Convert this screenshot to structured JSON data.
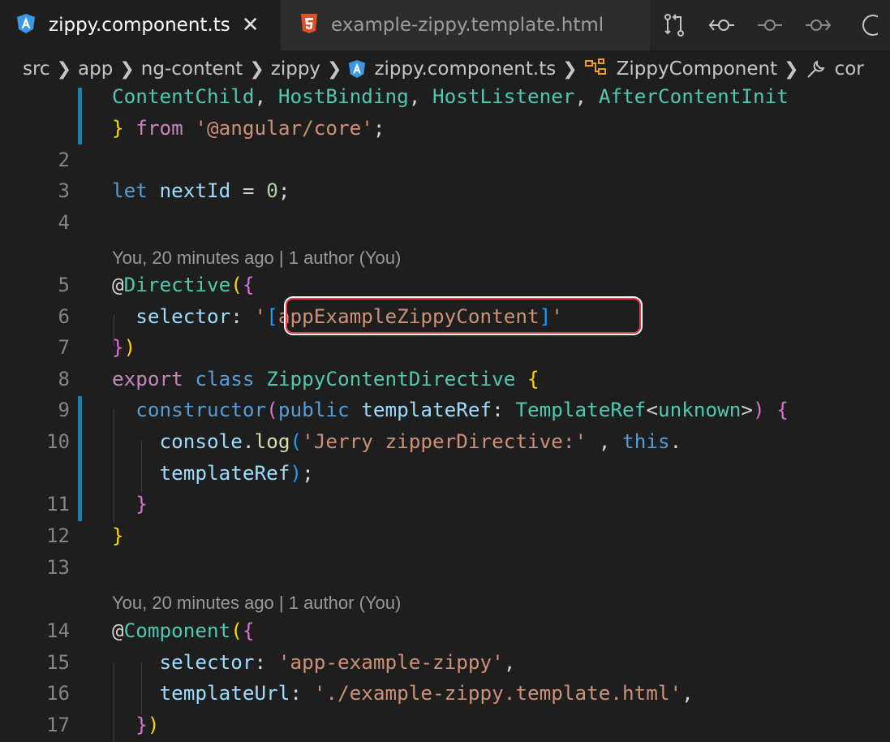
{
  "tabs": [
    {
      "label": "zippy.component.ts",
      "icon": "angular-icon",
      "active": true,
      "close": "✕"
    },
    {
      "label": "example-zippy.template.html",
      "icon": "html5-icon",
      "active": false
    }
  ],
  "toolbar": [
    "compare-changes-icon",
    "previous-change-icon",
    "current-change-icon",
    "next-change-icon",
    "more-icon"
  ],
  "breadcrumb": [
    "src",
    "app",
    "ng-content",
    "zippy",
    "zippy.component.ts",
    "ZippyComponent",
    "cor"
  ],
  "codelens": {
    "directive": "You, 20 minutes ago | 1 author (You)",
    "component": "You, 20 minutes ago | 1 author (You)"
  },
  "line_numbers": [
    "2",
    "3",
    "4",
    "5",
    "6",
    "7",
    "8",
    "9",
    "10",
    "11",
    "12",
    "13",
    "14",
    "15",
    "16",
    "17"
  ],
  "code": {
    "l1a_p1": "ContentChild",
    "l1a_p2": ", ",
    "l1a_p3": "HostBinding",
    "l1a_p4": ", ",
    "l1a_p5": "HostListener",
    "l1a_p6": ", ",
    "l1a_p7": "AfterContentInit",
    "l1b_p1": "}",
    "l1b_p2": " from ",
    "l1b_p3": "'@angular/core'",
    "l1b_p4": ";",
    "l3_p1": "let",
    "l3_p2": " nextId",
    "l3_p3": " = ",
    "l3_p4": "0",
    "l3_p5": ";",
    "l5_p1": "@",
    "l5_p2": "Directive",
    "l5_p3": "(",
    "l5_p4": "{",
    "l6_p1": "  selector",
    "l6_p2": ": ",
    "l6_p3": "'",
    "l6_p4": "[",
    "l6_p5": "appExampleZippyContent",
    "l6_p6": "]",
    "l6_p7": "'",
    "l7_p1": "}",
    "l7_p2": ")",
    "l8_p1": "export",
    "l8_p2": " class",
    "l8_p3": " ZippyContentDirective",
    "l8_p4": " {",
    "l9_p1": "  constructor",
    "l9_p2": "(",
    "l9_p3": "public",
    "l9_p4": " templateRef",
    "l9_p5": ": ",
    "l9_p6": "TemplateRef",
    "l9_p7": "<",
    "l9_p8": "unknown",
    "l9_p9": ">",
    "l9_p10": ")",
    "l9_p11": " {",
    "l10a_p1": "    console",
    "l10a_p2": ".",
    "l10a_p3": "log",
    "l10a_p4": "(",
    "l10a_p5": "'Jerry zipperDirective:'",
    "l10a_p6": " , ",
    "l10a_p7": "this",
    "l10a_p8": ".",
    "l10b_p1": "    templateRef",
    "l10b_p2": ")",
    "l10b_p3": ";",
    "l11_p1": "  }",
    "l12_p1": "}",
    "l14_p1": "@",
    "l14_p2": "Component",
    "l14_p3": "(",
    "l14_p4": "{",
    "l15_p1": "    selector",
    "l15_p2": ": ",
    "l15_p3": "'app-example-zippy'",
    "l15_p4": ",",
    "l16_p1": "    templateUrl",
    "l16_p2": ": ",
    "l16_p3": "'./example-zippy.template.html'",
    "l16_p4": ",",
    "l17_p1": "  }",
    "l17_p2": ")"
  },
  "colors": {
    "keyword": "#c586c0",
    "storage": "#569cd6",
    "variable": "#9cdcfe",
    "function": "#dcdcaa",
    "type": "#4ec9b0",
    "string": "#ce9178",
    "number": "#b5cea8",
    "highlight_border": "#e5394a",
    "modified_gutter": "#1b81a8"
  }
}
